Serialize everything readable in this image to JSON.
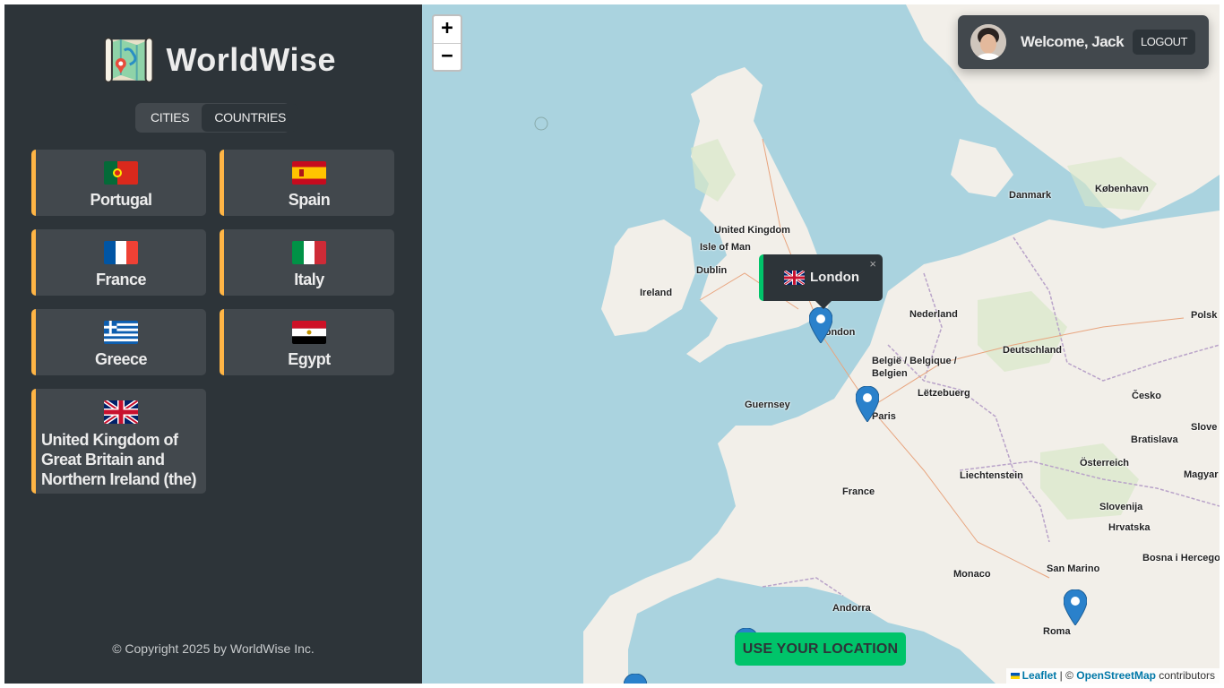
{
  "app": {
    "name": "WorldWise"
  },
  "tabs": [
    {
      "label": "Cities",
      "active": false
    },
    {
      "label": "Countries",
      "active": true
    }
  ],
  "countries": [
    {
      "name": "Portugal",
      "flag": "portugal-flag-icon"
    },
    {
      "name": "Spain",
      "flag": "spain-flag-icon"
    },
    {
      "name": "France",
      "flag": "france-flag-icon"
    },
    {
      "name": "Italy",
      "flag": "italy-flag-icon"
    },
    {
      "name": "Greece",
      "flag": "greece-flag-icon"
    },
    {
      "name": "Egypt",
      "flag": "egypt-flag-icon"
    },
    {
      "name": "United Kingdom of Great Britain and Northern Ireland (the)",
      "flag": "uk-flag-icon"
    }
  ],
  "footer": {
    "copyright": "© Copyright 2025 by WorldWise Inc."
  },
  "map": {
    "zoom_in": "+",
    "zoom_out": "−",
    "popup": {
      "city": "London",
      "close": "×"
    },
    "use_location_button": "USE YOUR LOCATION",
    "attribution": {
      "leaflet": "Leaflet",
      "sep": " | © ",
      "osm": "OpenStreetMap",
      "tail": " contributors"
    },
    "labels": {
      "uk": "United Kingdom",
      "isle_of_man": "Isle of Man",
      "ireland": "Ireland",
      "dublin": "Dublin",
      "london": "London",
      "paris": "Paris",
      "france": "France",
      "guernsey": "Guernsey",
      "nederland": "Nederland",
      "belgie": "België / Belgique / Belgien",
      "letzebuerg": "Lëtzebuerg",
      "deutschland": "Deutschland",
      "danmark": "Danmark",
      "kobenhavn": "København",
      "cesko": "Česko",
      "osterreich": "Österreich",
      "liechtenstein": "Liechtenstein",
      "slovenija": "Slovenija",
      "hrvatska": "Hrvatska",
      "bratislava": "Bratislava",
      "monaco": "Monaco",
      "san_marino": "San Marino",
      "andorra": "Andorra",
      "roma": "Roma",
      "polska": "Polsk",
      "magyar": "Magyar",
      "slove": "Slove",
      "bosna": "Bosna i Hercegovi"
    }
  },
  "user": {
    "welcome": "Welcome, Jack",
    "logout": "Logout"
  },
  "colors": {
    "accent_yellow": "#ffb545",
    "accent_green": "#00c46a",
    "dark": "#2d3439",
    "panel": "#42484d"
  }
}
